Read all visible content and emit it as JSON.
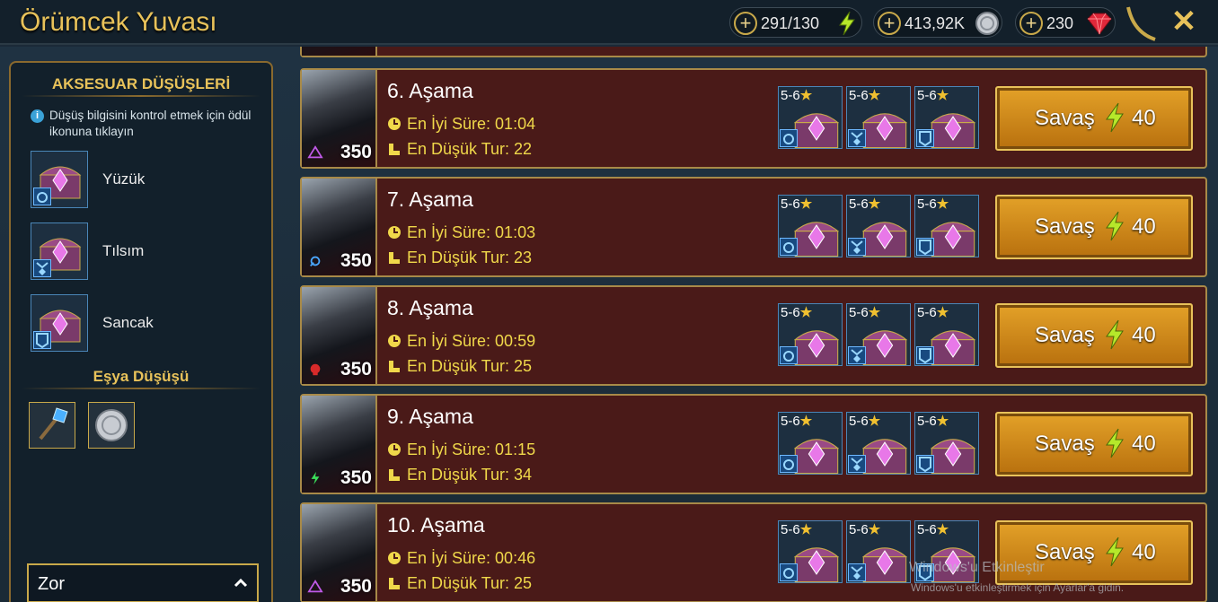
{
  "header": {
    "title": "Örümcek Yuvası",
    "resources": {
      "energy": "291/130",
      "silver": "413,92K",
      "gems": "230"
    },
    "close_icon": "close-icon"
  },
  "sidebar": {
    "heading": "AKSESUAR DÜŞÜŞLERİ",
    "info_text": "Düşüş bilgisini kontrol etmek için ödül ikonuna tıklayın",
    "accessories": [
      {
        "label": "Yüzük",
        "icon": "ring-icon"
      },
      {
        "label": "Tılsım",
        "icon": "amulet-icon"
      },
      {
        "label": "Sancak",
        "icon": "banner-icon"
      }
    ],
    "item_heading": "Eşya Düşüşü",
    "items": [
      {
        "icon": "potion-icon"
      },
      {
        "icon": "silver-coin-icon"
      }
    ],
    "difficulty": "Zor"
  },
  "stages": [
    {
      "name": "6. Aşama",
      "best_time": "En İyi Süre: 01:04",
      "min_turns": "En Düşük Tur: 22",
      "level": "350",
      "affinity": "void",
      "rewards": [
        "5-6",
        "5-6",
        "5-6"
      ],
      "fight_label": "Savaş",
      "cost": "40"
    },
    {
      "name": "7. Aşama",
      "best_time": "En İyi Süre: 01:03",
      "min_turns": "En Düşük Tur: 23",
      "level": "350",
      "affinity": "magic",
      "rewards": [
        "5-6",
        "5-6",
        "5-6"
      ],
      "fight_label": "Savaş",
      "cost": "40"
    },
    {
      "name": "8. Aşama",
      "best_time": "En İyi Süre: 00:59",
      "min_turns": "En Düşük Tur: 25",
      "level": "350",
      "affinity": "force",
      "rewards": [
        "5-6",
        "5-6",
        "5-6"
      ],
      "fight_label": "Savaş",
      "cost": "40"
    },
    {
      "name": "9. Aşama",
      "best_time": "En İyi Süre: 01:15",
      "min_turns": "En Düşük Tur: 34",
      "level": "350",
      "affinity": "spirit",
      "rewards": [
        "5-6",
        "5-6",
        "5-6"
      ],
      "fight_label": "Savaş",
      "cost": "40"
    },
    {
      "name": "10. Aşama",
      "best_time": "En İyi Süre: 00:46",
      "min_turns": "En Düşük Tur: 25",
      "level": "350",
      "affinity": "void",
      "rewards": [
        "5-6",
        "5-6",
        "5-6"
      ],
      "fight_label": "Savaş",
      "cost": "40"
    }
  ],
  "overlay": {
    "activate_title": "Windows'u Etkinleştir",
    "activate_sub": "Windows'u etkinleştirmek için Ayarlar'a gidin."
  },
  "colors": {
    "gold": "#e8c25a",
    "stat_yellow": "#f0d84a",
    "row_bg": "#4a1a18",
    "fight_button": "#d8901e"
  }
}
